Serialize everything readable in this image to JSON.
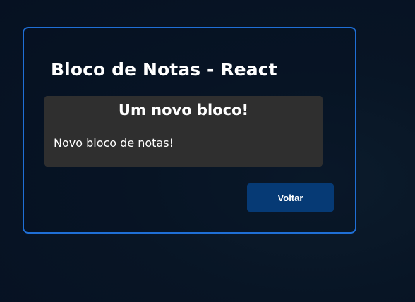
{
  "app": {
    "title": "Bloco de Notas - React"
  },
  "note": {
    "title": "Um novo bloco!",
    "body": "Novo bloco de notas!"
  },
  "actions": {
    "back_label": "Voltar"
  },
  "colors": {
    "background": "#071324",
    "card_border": "#1f6fd6",
    "note_background": "#2f2f2f",
    "button_background": "#063a75",
    "text": "#ffffff"
  }
}
